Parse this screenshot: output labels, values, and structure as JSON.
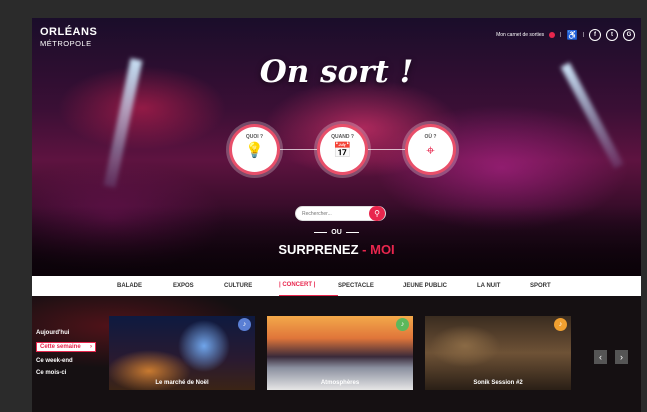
{
  "logo": {
    "line1": "ORLÉANS",
    "line2": "MÉTROPOLE"
  },
  "topbar": {
    "carnet_label": "Mon carnet de sorties"
  },
  "hero": {
    "title": "On sort !",
    "buttons": [
      {
        "label": "QUOI ?",
        "icon": "lightbulb-icon"
      },
      {
        "label": "QUAND ?",
        "icon": "calendar-icon"
      },
      {
        "label": "OÙ ?",
        "icon": "location-icon"
      }
    ],
    "search_placeholder": "Rechercher...",
    "ou": "OU",
    "surprenez": "SURPRENEZ",
    "moi": "MOI"
  },
  "nav": {
    "items": [
      "BALADE",
      "EXPOS",
      "CULTURE",
      "| CONCERT |",
      "SPECTACLE",
      "JEUNE PUBLIC",
      "LA NUIT",
      "SPORT"
    ],
    "active_index": 3
  },
  "periods": [
    "Aujourd'hui",
    "Cette semaine",
    "Ce week-end",
    "Ce mois-ci"
  ],
  "cards": [
    {
      "caption": "Le marché de Noël",
      "badge_color": "#5a7fd4"
    },
    {
      "caption": "Atmosphères",
      "badge_color": "#5cb85c"
    },
    {
      "caption": "Sonik Session #2",
      "badge_color": "#f0a030"
    }
  ],
  "colors": {
    "accent": "#e8264d"
  }
}
